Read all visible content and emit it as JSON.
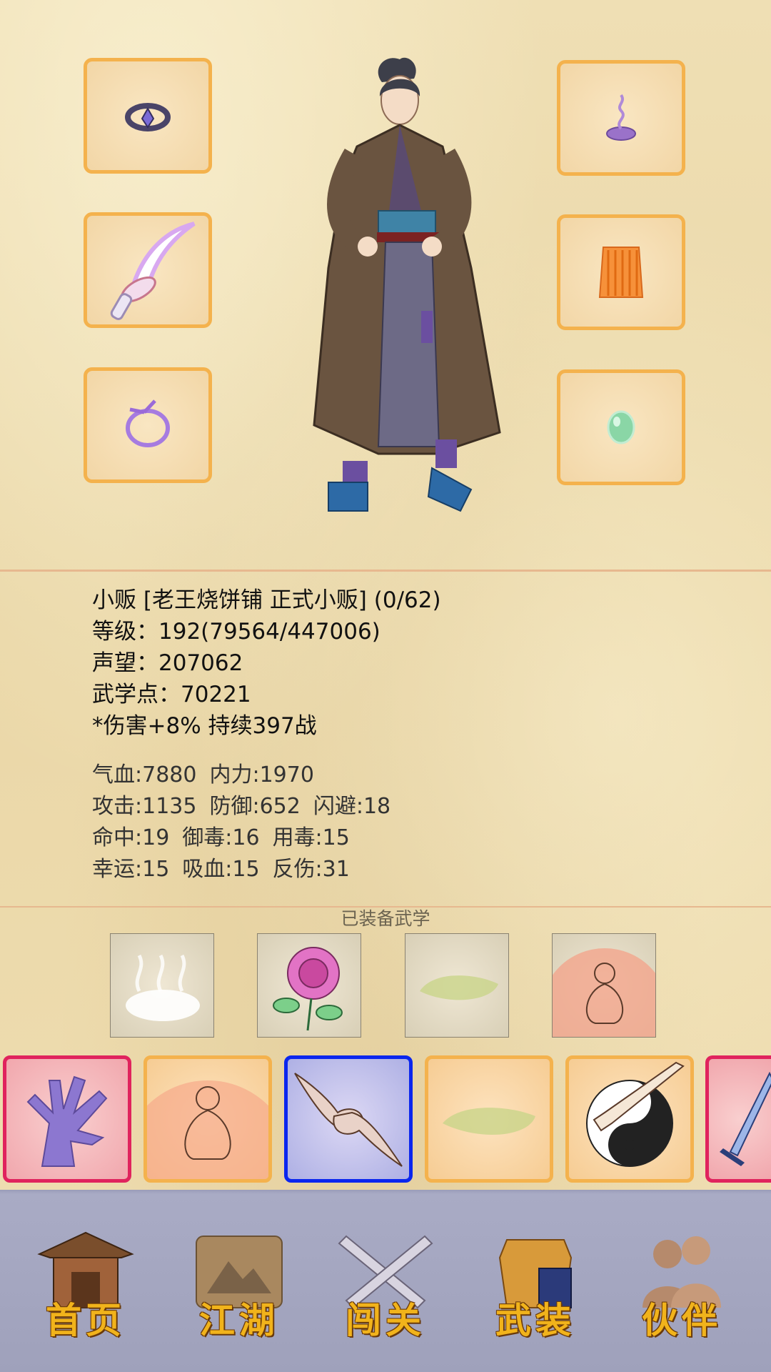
{
  "character": {
    "title_line": "小贩 [老王烧饼铺 正式小贩] (0/62)",
    "level_line": "等级：192(79564/447006)",
    "reputation_line": "声望：207062",
    "martial_points_line": "武学点：70221",
    "buff_line": "*伤害+8% 持续397战"
  },
  "stats": {
    "row1": [
      "气血:7880",
      "内力:1970"
    ],
    "row2": [
      "攻击:1135",
      "防御:652",
      "闪避:18"
    ],
    "row3": [
      "命中:19",
      "御毒:16",
      "用毒:15"
    ],
    "row4": [
      "幸运:15",
      "吸血:15",
      "反伤:31"
    ]
  },
  "equipment": {
    "left_slots": [
      "ring-icon",
      "curved-sword-icon",
      "bracelet-icon"
    ],
    "right_slots": [
      "incense-icon",
      "robe-icon",
      "jade-icon"
    ]
  },
  "equipped_martial": {
    "title": "已装备武学",
    "items": [
      "mist-icon",
      "rose-icon",
      "beast-icon",
      "meditation-icon"
    ]
  },
  "skill_bar": [
    {
      "icon": "palm-icon",
      "state": "red"
    },
    {
      "icon": "meditation-icon",
      "state": "normal"
    },
    {
      "icon": "fist-icon",
      "state": "selected"
    },
    {
      "icon": "beast-icon",
      "state": "normal"
    },
    {
      "icon": "taiji-icon",
      "state": "normal"
    },
    {
      "icon": "blade-icon",
      "state": "red"
    }
  ],
  "nav": {
    "home": "首页",
    "jianghu": "江湖",
    "challenge": "闯关",
    "gear": "武装",
    "partner": "伙伴"
  },
  "colors": {
    "slot_border": "#f4b24d",
    "skill_red": "#e0235d",
    "skill_selected": "#0b26ee",
    "nav_text": "#f1b31b"
  }
}
